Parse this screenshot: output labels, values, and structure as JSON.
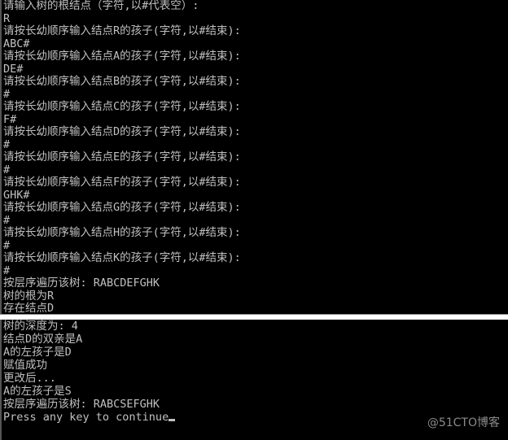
{
  "top_console": {
    "lines": [
      "请输入树的根结点（字符,以#代表空）:",
      "R",
      "请按长幼顺序输入结点R的孩子(字符,以#结束):",
      "ABC#",
      "请按长幼顺序输入结点A的孩子(字符,以#结束):",
      "DE#",
      "请按长幼顺序输入结点B的孩子(字符,以#结束):",
      "#",
      "请按长幼顺序输入结点C的孩子(字符,以#结束):",
      "F#",
      "请按长幼顺序输入结点D的孩子(字符,以#结束):",
      "#",
      "请按长幼顺序输入结点E的孩子(字符,以#结束):",
      "#",
      "请按长幼顺序输入结点F的孩子(字符,以#结束):",
      "GHK#",
      "请按长幼顺序输入结点G的孩子(字符,以#结束):",
      "#",
      "请按长幼顺序输入结点H的孩子(字符,以#结束):",
      "#",
      "请按长幼顺序输入结点K的孩子(字符,以#结束):",
      "#",
      "按层序遍历该树: RABCDEFGHK",
      "树的根为R",
      "存在结点D"
    ]
  },
  "bottom_console": {
    "lines": [
      "树的深度为: 4",
      "结点D的双亲是A",
      "A的左孩子是D",
      "赋值成功",
      "更改后...",
      "A的左孩子是S",
      "按层序遍历该树: RABCSEFGHK",
      "Press any key to continue"
    ]
  },
  "watermark": "@51CTO博客"
}
